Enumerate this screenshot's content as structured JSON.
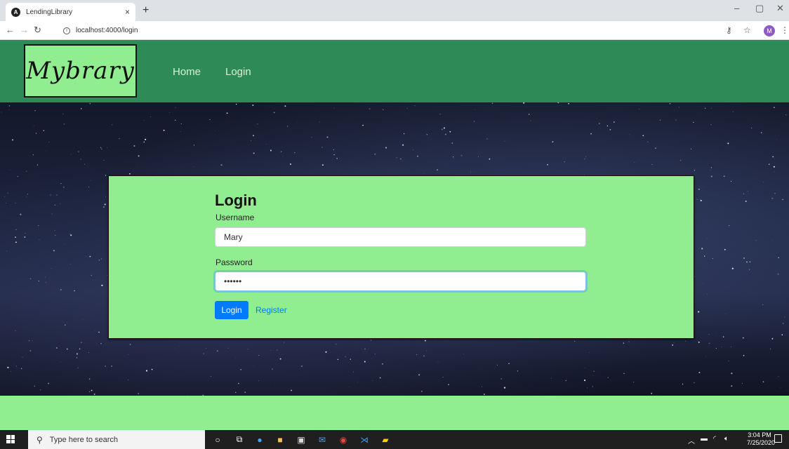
{
  "browser": {
    "tab_title": "LendingLibrary",
    "tab_close": "×",
    "new_tab": "+",
    "url": "localhost:4000/login",
    "profile_initial": "M",
    "window_controls": [
      "–",
      "▢",
      "✕"
    ]
  },
  "navbar": {
    "logo_text": "Mybrary",
    "links": [
      "Home",
      "Login"
    ]
  },
  "login_form": {
    "heading": "Login",
    "username_label": "Username",
    "username_value": "Mary",
    "password_label": "Password",
    "password_value": "••••••",
    "login_button": "Login",
    "register_link": "Register"
  },
  "taskbar": {
    "search_placeholder": "Type here to search",
    "time": "3:04 PM",
    "date": "7/25/2020"
  },
  "colors": {
    "navbar": "#2e8b57",
    "card": "#90ee90",
    "primary": "#007bff"
  },
  "icons": [
    "angular-icon",
    "back-icon",
    "forward-icon",
    "reload-icon",
    "info-icon",
    "key-icon",
    "star-icon",
    "search-icon",
    "cortana-icon",
    "task-view-icon",
    "edge-icon",
    "file-explorer-icon",
    "store-icon",
    "mail-icon",
    "chrome-icon",
    "vscode-icon",
    "sticky-notes-icon"
  ]
}
